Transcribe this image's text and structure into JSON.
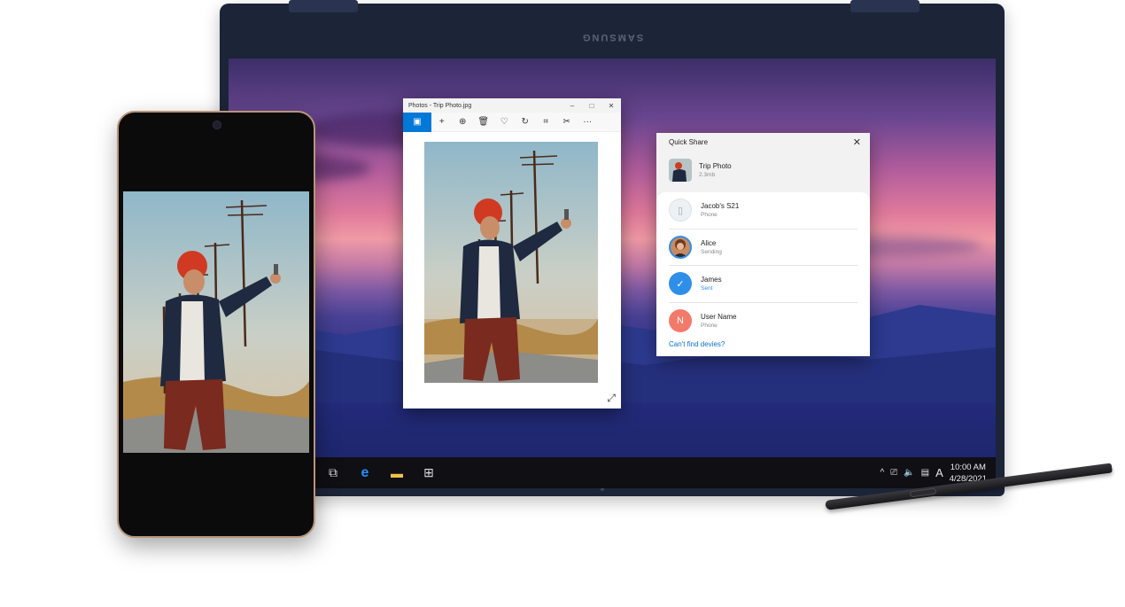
{
  "laptop": {
    "brand": "SAMSUNG"
  },
  "photos_window": {
    "title": "Photos - Trip Photo.jpg",
    "window_buttons": [
      "–",
      "□",
      "✕"
    ],
    "toolbar_icons": [
      "image-icon",
      "plus-icon",
      "zoom-icon",
      "delete-icon",
      "heart-icon",
      "rotate-icon",
      "crop-icon",
      "edit-icon",
      "more-icon"
    ],
    "toolbar_glyphs": [
      "▣",
      "+",
      "⊕",
      "🗑",
      "♡",
      "↻",
      "⌗",
      "✂",
      "···"
    ],
    "expand_glyph": "⤢"
  },
  "quick_share": {
    "title": "Quick Share",
    "close_glyph": "✕",
    "file": {
      "name": "Trip Photo",
      "size": "2.3mb"
    },
    "devices": [
      {
        "name": "Jacob's S21",
        "status": "Phone",
        "avatar": "phone-icon",
        "avatar_glyph": "▯"
      },
      {
        "name": "Alice",
        "status": "Sending",
        "avatar": "person-photo"
      },
      {
        "name": "James",
        "status": "Sent",
        "avatar": "check-icon",
        "avatar_glyph": "✓"
      },
      {
        "name": "User Name",
        "status": "Phone",
        "avatar": "initial",
        "avatar_glyph": "N"
      }
    ],
    "help_link": "Can't find devies?"
  },
  "taskbar": {
    "icons": [
      "task-view-icon",
      "edge-icon",
      "file-explorer-icon",
      "store-icon"
    ],
    "glyphs": [
      "⧉",
      "e",
      "▬",
      "⊞"
    ],
    "tray_glyphs": [
      "^",
      "⎚",
      "🔈",
      "▤",
      "A"
    ],
    "time": "10:00 AM",
    "date": "4/28/2021"
  },
  "colors": {
    "accent": "#0078d7",
    "sent": "#2f8fe8",
    "initial_avatar": "#f27a6b",
    "link": "#0a6fd0"
  }
}
